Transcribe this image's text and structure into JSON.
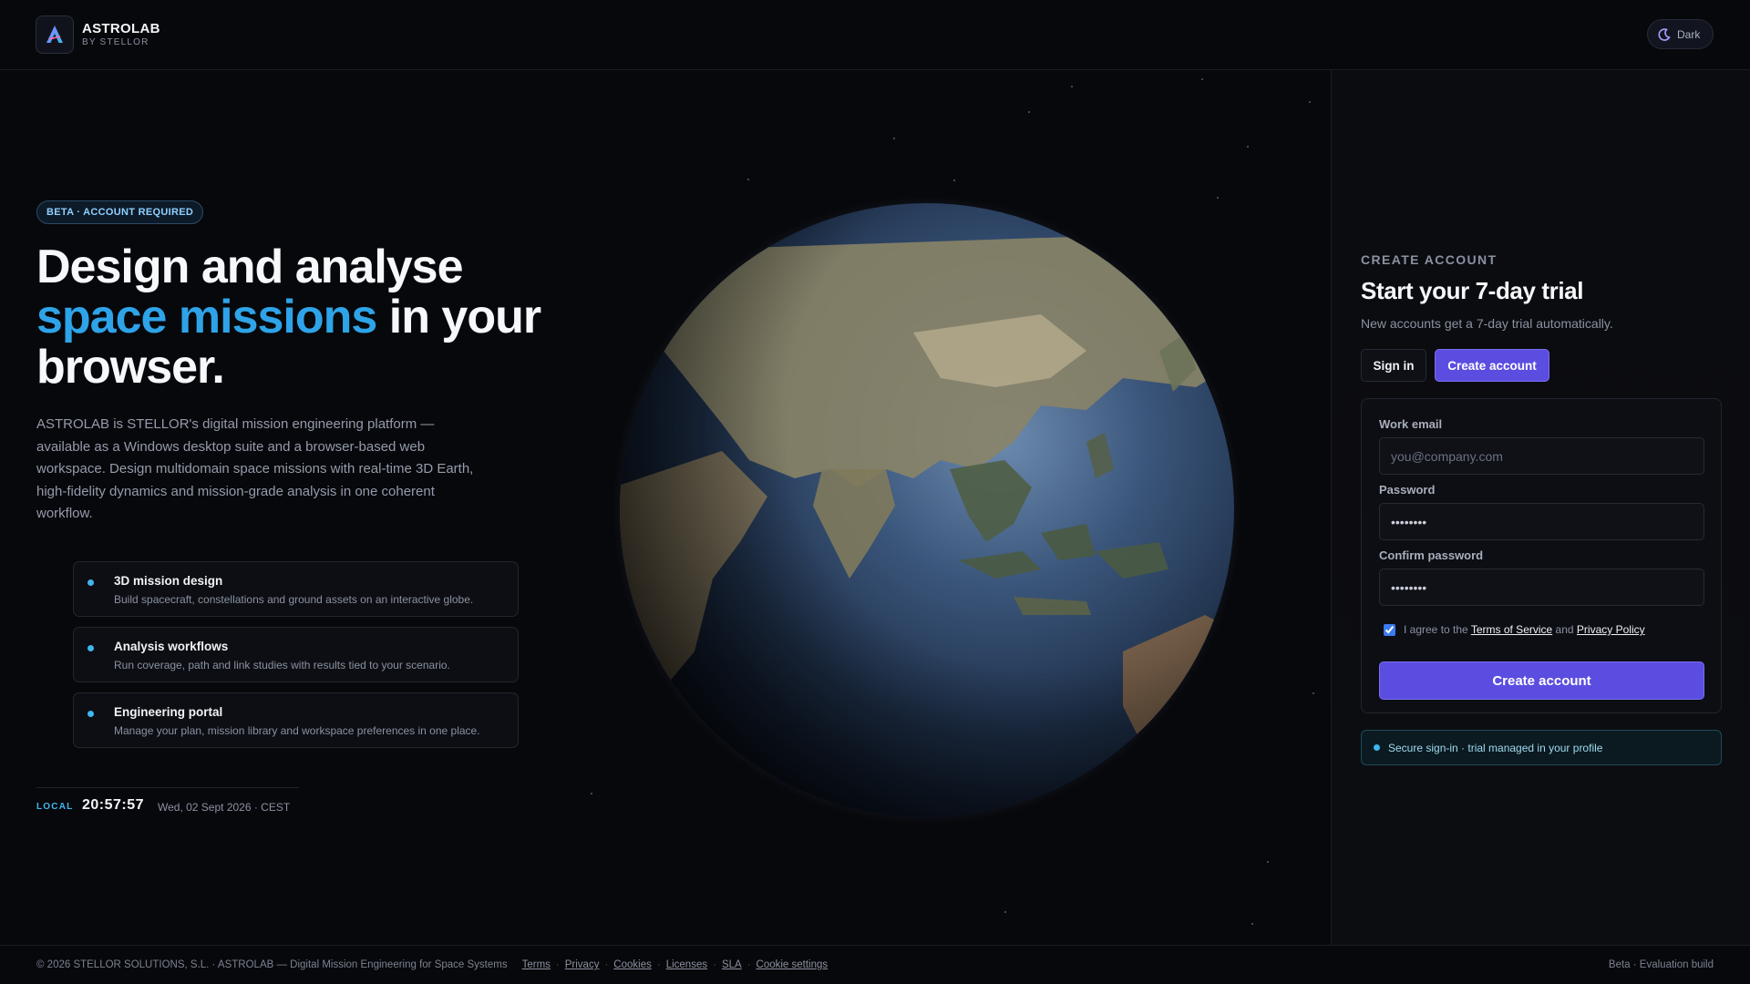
{
  "brand": {
    "name": "ASTROLAB",
    "tagline": "BY STELLOR"
  },
  "theme_toggle": {
    "label": "Dark"
  },
  "hero": {
    "badge": "BETA · ACCOUNT REQUIRED",
    "headline_line1": "Design and analyse",
    "headline_accent": "space missions",
    "headline_rest": " in your",
    "headline_line3": "browser.",
    "intro": "ASTROLAB is STELLOR's digital mission engineering platform — available as a Windows desktop suite and a browser-based web workspace. Design multidomain space missions with real-time 3D Earth, high-fidelity dynamics and mission-grade analysis in one coherent workflow."
  },
  "features": [
    {
      "title": "3D mission design",
      "desc": "Build spacecraft, constellations and ground assets on an interactive globe."
    },
    {
      "title": "Analysis workflows",
      "desc": "Run coverage, path and link studies with results tied to your scenario."
    },
    {
      "title": "Engineering portal",
      "desc": "Manage your plan, mission library and workspace preferences in one place."
    }
  ],
  "clock": {
    "label": "LOCAL",
    "time": "20:57:57",
    "date": "Wed, 02 Sept 2026 · CEST"
  },
  "auth": {
    "eyebrow": "CREATE ACCOUNT",
    "title": "Start your 7-day trial",
    "subtitle": "New accounts get a 7-day trial automatically.",
    "tab_signin": "Sign in",
    "tab_create": "Create account",
    "email_label": "Work email",
    "email_placeholder": "you@company.com",
    "password_label": "Password",
    "password_value": "••••••••",
    "confirm_label": "Confirm password",
    "confirm_value": "••••••••",
    "agree_prefix": "I agree to the",
    "terms_link": "Terms of Service",
    "agree_and": "and",
    "privacy_link": "Privacy Policy",
    "submit": "Create account",
    "secure_note": "Secure sign-in · trial managed in your profile"
  },
  "footer": {
    "copyright": "© 2026 STELLOR SOLUTIONS, S.L. · ASTROLAB — Digital Mission Engineering for Space Systems",
    "links": [
      "Terms",
      "Privacy",
      "Cookies",
      "Licenses",
      "SLA",
      "Cookie settings"
    ],
    "build": "Beta · Evaluation build"
  },
  "colors": {
    "accent": "#2ea3e8",
    "primary_button": "#5b4de0",
    "background": "#07080b"
  }
}
